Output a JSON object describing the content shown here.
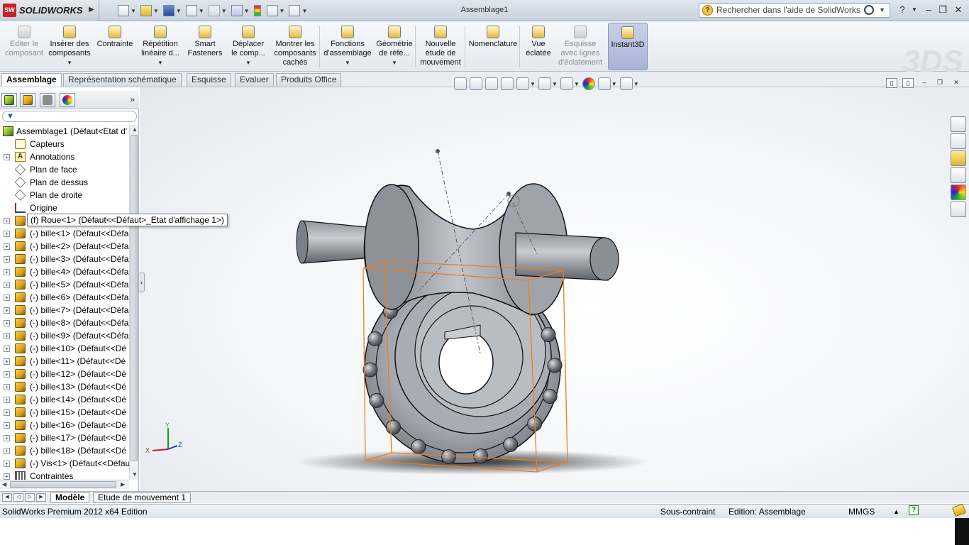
{
  "app": {
    "logo_text": "SOLIDWORKS",
    "window_title": "Assemblage1",
    "search_placeholder": "Rechercher dans l'aide de SolidWorks",
    "accent": "#c8202a"
  },
  "command_manager": {
    "tools": [
      {
        "label_lines": [
          "Editer le",
          "composant"
        ],
        "icon": "edit-component-icon",
        "enabled": false
      },
      {
        "label_lines": [
          "Insérer des",
          "composants"
        ],
        "icon": "insert-components-icon",
        "enabled": true,
        "dropdown": true
      },
      {
        "label_lines": [
          "Contrainte"
        ],
        "icon": "mate-icon",
        "enabled": true
      },
      {
        "label_lines": [
          "Répétition",
          "linéaire d..."
        ],
        "icon": "linear-pattern-icon",
        "enabled": true,
        "dropdown": true
      },
      {
        "label_lines": [
          "Smart",
          "Fasteners"
        ],
        "icon": "smart-fasteners-icon",
        "enabled": true
      },
      {
        "label_lines": [
          "Déplacer",
          "le comp..."
        ],
        "icon": "move-component-icon",
        "enabled": true,
        "dropdown": true
      },
      {
        "label_lines": [
          "Montrer les",
          "composants",
          "cachés"
        ],
        "icon": "show-hidden-icon",
        "enabled": true
      },
      {
        "label_lines": [
          "Fonctions",
          "d'assemblage"
        ],
        "icon": "assembly-features-icon",
        "enabled": true,
        "dropdown": true
      },
      {
        "label_lines": [
          "Géométrie",
          "de réfé..."
        ],
        "icon": "reference-geometry-icon",
        "enabled": true,
        "dropdown": true
      },
      {
        "label_lines": [
          "Nouvelle",
          "étude de",
          "mouvement"
        ],
        "icon": "motion-study-icon",
        "enabled": true
      },
      {
        "label_lines": [
          "Nomenclature"
        ],
        "icon": "bom-icon",
        "enabled": true
      },
      {
        "label_lines": [
          "Vue",
          "éclatée"
        ],
        "icon": "exploded-view-icon",
        "enabled": true
      },
      {
        "label_lines": [
          "Esquisse",
          "avec lignes",
          "d'éclatement"
        ],
        "icon": "explode-line-sketch-icon",
        "enabled": false
      },
      {
        "label_lines": [
          "Instant3D"
        ],
        "icon": "instant3d-icon",
        "enabled": true,
        "active": true
      }
    ],
    "tabs": [
      "Assemblage",
      "Représentation schématique",
      "Esquisse",
      "Evaluer",
      "Produits Office"
    ],
    "active_tab": "Assemblage"
  },
  "feature_tree": {
    "root": "Assemblage1  (Défaut<Etat d'",
    "items": [
      {
        "label": "Capteurs",
        "icon": "sensor-icon",
        "expandable": false
      },
      {
        "label": "Annotations",
        "icon": "annotations-icon",
        "expandable": true
      },
      {
        "label": "Plan de face",
        "icon": "plane-icon",
        "expandable": false
      },
      {
        "label": "Plan de dessus",
        "icon": "plane-icon",
        "expandable": false
      },
      {
        "label": "Plan de droite",
        "icon": "plane-icon",
        "expandable": false
      },
      {
        "label": "Origine",
        "icon": "origin-icon",
        "expandable": false
      },
      {
        "label": "",
        "icon": "part-icon",
        "expandable": true
      },
      {
        "label": "(-) bille<1>  (Défaut<<Défa",
        "icon": "part-icon",
        "expandable": true
      },
      {
        "label": "(-) bille<2>  (Défaut<<Défa",
        "icon": "part-icon",
        "expandable": true
      },
      {
        "label": "(-) bille<3>  (Défaut<<Défa",
        "icon": "part-icon",
        "expandable": true
      },
      {
        "label": "(-) bille<4>  (Défaut<<Défa",
        "icon": "part-icon",
        "expandable": true
      },
      {
        "label": "(-) bille<5>  (Défaut<<Défa",
        "icon": "part-icon",
        "expandable": true
      },
      {
        "label": "(-) bille<6>  (Défaut<<Défa",
        "icon": "part-icon",
        "expandable": true
      },
      {
        "label": "(-) bille<7>  (Défaut<<Défa",
        "icon": "part-icon",
        "expandable": true
      },
      {
        "label": "(-) bille<8>  (Défaut<<Défa",
        "icon": "part-icon",
        "expandable": true
      },
      {
        "label": "(-) bille<9>  (Défaut<<Défa",
        "icon": "part-icon",
        "expandable": true
      },
      {
        "label": "(-) bille<10>  (Défaut<<Dé",
        "icon": "part-icon",
        "expandable": true
      },
      {
        "label": "(-) bille<11>  (Défaut<<Dé",
        "icon": "part-icon",
        "expandable": true
      },
      {
        "label": "(-) bille<12>  (Défaut<<Dé",
        "icon": "part-icon",
        "expandable": true
      },
      {
        "label": "(-) bille<13>  (Défaut<<Dé",
        "icon": "part-icon",
        "expandable": true
      },
      {
        "label": "(-) bille<14>  (Défaut<<Dé",
        "icon": "part-icon",
        "expandable": true
      },
      {
        "label": "(-) bille<15>  (Défaut<<Dé",
        "icon": "part-icon",
        "expandable": true
      },
      {
        "label": "(-) bille<16>  (Défaut<<Dé",
        "icon": "part-icon",
        "expandable": true
      },
      {
        "label": "(-) bille<17>  (Défaut<<Dé",
        "icon": "part-icon",
        "expandable": true
      },
      {
        "label": "(-) bille<18>  (Défaut<<Dé",
        "icon": "part-icon",
        "expandable": true
      },
      {
        "label": "(-) Vis<1>  (Défaut<<Défau",
        "icon": "part-icon",
        "expandable": true
      },
      {
        "label": "Contraintes",
        "icon": "mates-icon",
        "expandable": true
      }
    ],
    "tooltip": "(f) Roue<1>  (Défaut<<Défaut>_Etat d'affichage 1>)"
  },
  "viewport": {
    "triad_labels": {
      "x": "X",
      "y": "Y",
      "z": "Z"
    }
  },
  "bottom_tabs": [
    "Modèle",
    "Etude de mouvement 1"
  ],
  "active_bottom_tab": "Modèle",
  "status": {
    "product": "SolidWorks Premium 2012 x64 Edition",
    "constraint": "Sous-contraint",
    "edit_mode": "Edition: Assemblage",
    "units": "MMGS"
  }
}
